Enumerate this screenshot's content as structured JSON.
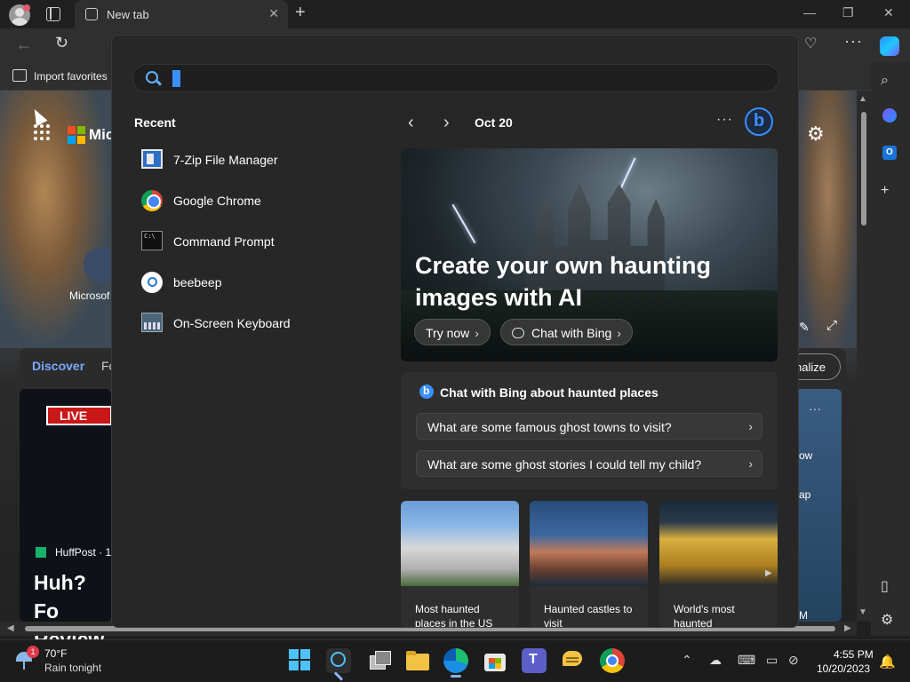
{
  "browser": {
    "tab_title": "New tab",
    "new_tab_symbol": "+",
    "tab_close_symbol": "✕",
    "window_controls": [
      "—",
      "❐",
      "✕"
    ],
    "favorites_bar": {
      "import_label": "Import favorites"
    },
    "more_symbol": "···"
  },
  "page": {
    "brand_partial": "Mic",
    "shortcut_label_partial": "Microsof",
    "feed_tab_active": "Discover",
    "feed_tab_next_partial": "Fo",
    "personalize_partial": "nalize",
    "live_badge": "LIVE",
    "source_name": "HuffPost · 1",
    "headline_partial": "Huh? Fo Review",
    "right_card_text1": "ow",
    "right_card_text2": "ap",
    "right_card_text3": "M",
    "more_dots": "···"
  },
  "search": {
    "recent_title": "Recent",
    "recent_items": [
      {
        "label": "7-Zip File Manager",
        "icon": "7zip-icon"
      },
      {
        "label": "Google Chrome",
        "icon": "chrome-icon"
      },
      {
        "label": "Command Prompt",
        "icon": "cmd-icon"
      },
      {
        "label": "beebeep",
        "icon": "search-result-icon"
      },
      {
        "label": "On-Screen Keyboard",
        "icon": "keyboard-icon"
      }
    ],
    "date": "Oct 20",
    "more_symbol": "···",
    "hero": {
      "title": "Create your own haunting images with AI",
      "try_now": "Try now",
      "chat_with_bing": "Chat with Bing"
    },
    "chat_card": {
      "title": "Chat with Bing about haunted places",
      "suggestions": [
        "What are some famous ghost towns to visit?",
        "What are some ghost stories I could tell my child?"
      ]
    },
    "thumbnails": [
      {
        "label": "Most haunted places in the US"
      },
      {
        "label": "Haunted castles to visit"
      },
      {
        "label": "World's most haunted"
      }
    ]
  },
  "taskbar": {
    "weather_temp": "70°F",
    "weather_desc": "Rain tonight",
    "weather_badge": "1",
    "time": "4:55 PM",
    "date": "10/20/2023"
  }
}
